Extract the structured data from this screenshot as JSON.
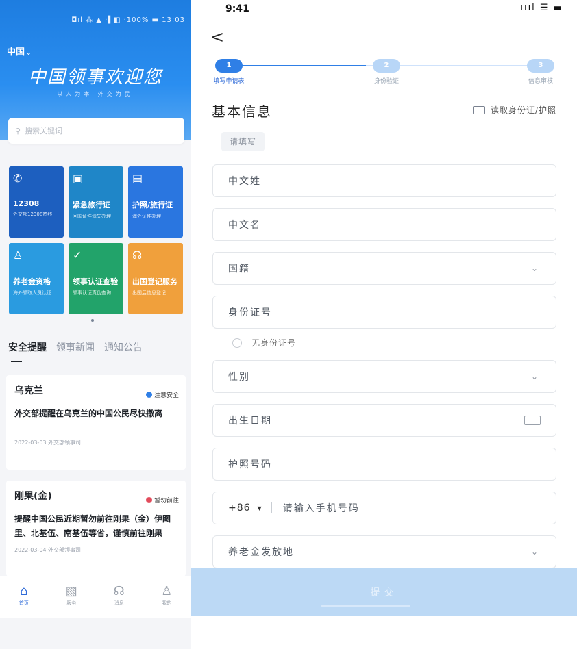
{
  "left": {
    "status_bar": "◘ıl ⁂ ▲ ·▌◧ ·100% ▬ 13:03",
    "region": "中国",
    "title": "中国领事欢迎您",
    "subtitle": "以人为本  外交为民",
    "search_placeholder": "搜索关键词",
    "tiles": [
      {
        "icon": "✆",
        "title": "12308",
        "sub": "外交部12308热线",
        "color": "#1d5fbf"
      },
      {
        "icon": "▣",
        "title": "紧急旅行证",
        "sub": "回国证件遗失办理",
        "color": "#1f86c8"
      },
      {
        "icon": "▤",
        "title": "护照/旅行证",
        "sub": "海外证件办理",
        "color": "#2a76e0"
      },
      {
        "icon": "♙",
        "title": "养老金资格",
        "sub": "海外领取人员认证",
        "color": "#2a9be0"
      },
      {
        "icon": "✓",
        "title": "领事认证查验",
        "sub": "领事认证真伪查询",
        "color": "#22a36a"
      },
      {
        "icon": "☊",
        "title": "出国登记服务",
        "sub": "出国后信息登记",
        "color": "#f0a03c"
      }
    ],
    "news_tabs": [
      "安全提醒",
      "领事新闻",
      "通知公告"
    ],
    "cards": [
      {
        "title": "乌克兰",
        "badge": "注意安全",
        "badge_color": "#2f7fe6",
        "body": "外交部提醒在乌克兰的中国公民尽快撤离",
        "date": "2022-03-03  外交部领事司"
      },
      {
        "title": "刚果(金)",
        "badge": "暂勿前往",
        "badge_color": "#e24b5b",
        "body": "提醒中国公民近期暂勿前往刚果（金）伊图里、北基伍、南基伍等省，谨慎前往刚果",
        "date": "2022-03-04  外交部领事司"
      }
    ],
    "nav": [
      {
        "icon": "⌂",
        "label": "首页",
        "name": "home"
      },
      {
        "icon": "▧",
        "label": "服务",
        "name": "services"
      },
      {
        "icon": "☊",
        "label": "消息",
        "name": "messages"
      },
      {
        "icon": "♙",
        "label": "我的",
        "name": "profile"
      }
    ]
  },
  "right": {
    "time": "9:41",
    "status_icons": "ıııl ☰ ▬",
    "back": "<",
    "steps": [
      {
        "num": "1",
        "label": "填写申请表",
        "active": true
      },
      {
        "num": "2",
        "label": "身份验证",
        "active": false
      },
      {
        "num": "3",
        "label": "信息审核",
        "active": false
      }
    ],
    "section_title": "基本信息",
    "read_id_label": "读取身份证/护照",
    "read_tag": "请填写",
    "fields": {
      "surname": "中文姓",
      "given_name": "中文名",
      "nationality": "国籍",
      "id_number": "身份证号",
      "no_id": "无身份证号",
      "gender": "性别",
      "birth_date": "出生日期",
      "passport": "护照号码",
      "country_code": "+86",
      "phone_placeholder": "请输入手机号码",
      "pension_place": "养老金发放地"
    },
    "submit": "提交"
  }
}
